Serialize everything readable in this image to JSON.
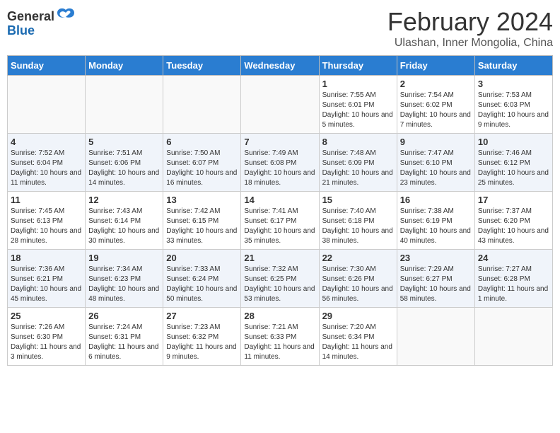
{
  "header": {
    "logo_general": "General",
    "logo_blue": "Blue",
    "month_year": "February 2024",
    "location": "Ulashan, Inner Mongolia, China"
  },
  "days_of_week": [
    "Sunday",
    "Monday",
    "Tuesday",
    "Wednesday",
    "Thursday",
    "Friday",
    "Saturday"
  ],
  "weeks": [
    {
      "row_class": "row-odd",
      "days": [
        {
          "num": "",
          "info": ""
        },
        {
          "num": "",
          "info": ""
        },
        {
          "num": "",
          "info": ""
        },
        {
          "num": "",
          "info": ""
        },
        {
          "num": "1",
          "info": "Sunrise: 7:55 AM\nSunset: 6:01 PM\nDaylight: 10 hours and 5 minutes."
        },
        {
          "num": "2",
          "info": "Sunrise: 7:54 AM\nSunset: 6:02 PM\nDaylight: 10 hours and 7 minutes."
        },
        {
          "num": "3",
          "info": "Sunrise: 7:53 AM\nSunset: 6:03 PM\nDaylight: 10 hours and 9 minutes."
        }
      ]
    },
    {
      "row_class": "row-even",
      "days": [
        {
          "num": "4",
          "info": "Sunrise: 7:52 AM\nSunset: 6:04 PM\nDaylight: 10 hours and 11 minutes."
        },
        {
          "num": "5",
          "info": "Sunrise: 7:51 AM\nSunset: 6:06 PM\nDaylight: 10 hours and 14 minutes."
        },
        {
          "num": "6",
          "info": "Sunrise: 7:50 AM\nSunset: 6:07 PM\nDaylight: 10 hours and 16 minutes."
        },
        {
          "num": "7",
          "info": "Sunrise: 7:49 AM\nSunset: 6:08 PM\nDaylight: 10 hours and 18 minutes."
        },
        {
          "num": "8",
          "info": "Sunrise: 7:48 AM\nSunset: 6:09 PM\nDaylight: 10 hours and 21 minutes."
        },
        {
          "num": "9",
          "info": "Sunrise: 7:47 AM\nSunset: 6:10 PM\nDaylight: 10 hours and 23 minutes."
        },
        {
          "num": "10",
          "info": "Sunrise: 7:46 AM\nSunset: 6:12 PM\nDaylight: 10 hours and 25 minutes."
        }
      ]
    },
    {
      "row_class": "row-odd",
      "days": [
        {
          "num": "11",
          "info": "Sunrise: 7:45 AM\nSunset: 6:13 PM\nDaylight: 10 hours and 28 minutes."
        },
        {
          "num": "12",
          "info": "Sunrise: 7:43 AM\nSunset: 6:14 PM\nDaylight: 10 hours and 30 minutes."
        },
        {
          "num": "13",
          "info": "Sunrise: 7:42 AM\nSunset: 6:15 PM\nDaylight: 10 hours and 33 minutes."
        },
        {
          "num": "14",
          "info": "Sunrise: 7:41 AM\nSunset: 6:17 PM\nDaylight: 10 hours and 35 minutes."
        },
        {
          "num": "15",
          "info": "Sunrise: 7:40 AM\nSunset: 6:18 PM\nDaylight: 10 hours and 38 minutes."
        },
        {
          "num": "16",
          "info": "Sunrise: 7:38 AM\nSunset: 6:19 PM\nDaylight: 10 hours and 40 minutes."
        },
        {
          "num": "17",
          "info": "Sunrise: 7:37 AM\nSunset: 6:20 PM\nDaylight: 10 hours and 43 minutes."
        }
      ]
    },
    {
      "row_class": "row-even",
      "days": [
        {
          "num": "18",
          "info": "Sunrise: 7:36 AM\nSunset: 6:21 PM\nDaylight: 10 hours and 45 minutes."
        },
        {
          "num": "19",
          "info": "Sunrise: 7:34 AM\nSunset: 6:23 PM\nDaylight: 10 hours and 48 minutes."
        },
        {
          "num": "20",
          "info": "Sunrise: 7:33 AM\nSunset: 6:24 PM\nDaylight: 10 hours and 50 minutes."
        },
        {
          "num": "21",
          "info": "Sunrise: 7:32 AM\nSunset: 6:25 PM\nDaylight: 10 hours and 53 minutes."
        },
        {
          "num": "22",
          "info": "Sunrise: 7:30 AM\nSunset: 6:26 PM\nDaylight: 10 hours and 56 minutes."
        },
        {
          "num": "23",
          "info": "Sunrise: 7:29 AM\nSunset: 6:27 PM\nDaylight: 10 hours and 58 minutes."
        },
        {
          "num": "24",
          "info": "Sunrise: 7:27 AM\nSunset: 6:28 PM\nDaylight: 11 hours and 1 minute."
        }
      ]
    },
    {
      "row_class": "row-odd",
      "days": [
        {
          "num": "25",
          "info": "Sunrise: 7:26 AM\nSunset: 6:30 PM\nDaylight: 11 hours and 3 minutes."
        },
        {
          "num": "26",
          "info": "Sunrise: 7:24 AM\nSunset: 6:31 PM\nDaylight: 11 hours and 6 minutes."
        },
        {
          "num": "27",
          "info": "Sunrise: 7:23 AM\nSunset: 6:32 PM\nDaylight: 11 hours and 9 minutes."
        },
        {
          "num": "28",
          "info": "Sunrise: 7:21 AM\nSunset: 6:33 PM\nDaylight: 11 hours and 11 minutes."
        },
        {
          "num": "29",
          "info": "Sunrise: 7:20 AM\nSunset: 6:34 PM\nDaylight: 11 hours and 14 minutes."
        },
        {
          "num": "",
          "info": ""
        },
        {
          "num": "",
          "info": ""
        }
      ]
    }
  ]
}
